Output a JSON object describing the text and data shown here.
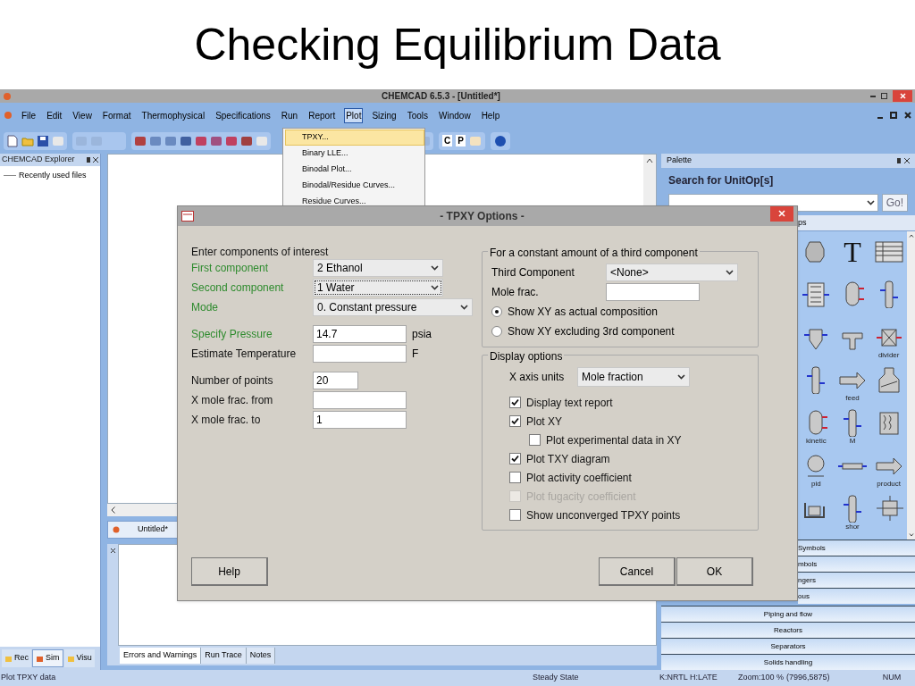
{
  "slide_title": "Checking Equilibrium Data",
  "window": {
    "title": "CHEMCAD 6.5.3 - [Untitled*]"
  },
  "menu": [
    {
      "label": "File",
      "selected": false
    },
    {
      "label": "Edit",
      "selected": false
    },
    {
      "label": "View",
      "selected": false
    },
    {
      "label": "Format",
      "selected": false
    },
    {
      "label": "Thermophysical",
      "selected": false
    },
    {
      "label": "Specifications",
      "selected": false
    },
    {
      "label": "Run",
      "selected": false
    },
    {
      "label": "Report",
      "selected": false
    },
    {
      "label": "Plot",
      "selected": true
    },
    {
      "label": "Sizing",
      "selected": false
    },
    {
      "label": "Tools",
      "selected": false
    },
    {
      "label": "Window",
      "selected": false
    },
    {
      "label": "Help",
      "selected": false
    }
  ],
  "plot_menu": [
    {
      "label": "TPXY...",
      "selected": true
    },
    {
      "label": "Binary LLE...",
      "selected": false
    },
    {
      "label": "Binodal Plot...",
      "selected": false
    },
    {
      "label": "Binodal/Residue Curves...",
      "selected": false
    },
    {
      "label": "Residue Curves...",
      "selected": false
    }
  ],
  "toolbar": {
    "letter_buttons": [
      "C",
      "P"
    ]
  },
  "explorer": {
    "title": "CHEMCAD Explorer",
    "items": [
      "Recently used files"
    ],
    "tabs": [
      {
        "label": "Rec",
        "selected": false
      },
      {
        "label": "Sim",
        "selected": true
      },
      {
        "label": "Visu",
        "selected": false
      }
    ]
  },
  "document_tab": "Untitled*",
  "message_tabs": [
    {
      "label": "Errors and Warnings",
      "selected": true
    },
    {
      "label": "Run Trace",
      "selected": false
    },
    {
      "label": "Notes",
      "selected": false
    }
  ],
  "palette": {
    "title": "Palette",
    "search_label": "Search for UnitOp[s]",
    "go_button": "Go!",
    "tab": "ps",
    "items": [
      {
        "kind": "icon"
      },
      {
        "kind": "glyph",
        "glyph": "T"
      },
      {
        "kind": "icon"
      },
      {
        "kind": "icon"
      },
      {
        "kind": "icon"
      },
      {
        "kind": "icon"
      },
      {
        "kind": "icon"
      },
      {
        "kind": "icon"
      },
      {
        "kind": "icon",
        "label": "divider"
      },
      {
        "kind": "icon"
      },
      {
        "kind": "icon",
        "label": "feed"
      },
      {
        "kind": "icon"
      },
      {
        "kind": "icon",
        "label": "kinetic"
      },
      {
        "kind": "icon",
        "label": "M"
      },
      {
        "kind": "icon"
      },
      {
        "kind": "icon",
        "label": "pid"
      },
      {
        "kind": "icon"
      },
      {
        "kind": "icon",
        "label": "product"
      },
      {
        "kind": "icon"
      },
      {
        "kind": "icon",
        "label": "shor"
      },
      {
        "kind": "icon"
      }
    ],
    "partial_categories": [
      "Symbols",
      "mbols",
      "ngers",
      "ous"
    ],
    "categories": [
      "Piping and flow",
      "Reactors",
      "Separators",
      "Solids handling"
    ]
  },
  "dialog": {
    "title": "- TPXY Options -",
    "section": "Enter components of interest",
    "field_groups": [
      [
        {
          "label": "First component",
          "required": true,
          "kind": "select",
          "value": "2 Ethanol",
          "focused": false
        },
        {
          "label": "Second component",
          "required": true,
          "kind": "select",
          "value": "1 Water",
          "focused": true
        },
        {
          "label": "Mode",
          "required": true,
          "kind": "wide_select",
          "value": "0. Constant pressure",
          "focused": false
        }
      ],
      [
        {
          "label": "Specify Pressure",
          "required": true,
          "kind": "input",
          "value": "14.7",
          "unit": "psia",
          "focused": false
        },
        {
          "label": "Estimate Temperature",
          "required": false,
          "kind": "input",
          "unit": "F",
          "focused": false
        }
      ],
      [
        {
          "label": "Number of points",
          "required": false,
          "kind": "short_input",
          "value": "20",
          "focused": false
        },
        {
          "label": "X mole frac. from",
          "required": false,
          "kind": "input",
          "focused": false
        },
        {
          "label": "X mole frac. to",
          "required": false,
          "kind": "input",
          "value": "1",
          "focused": false
        }
      ]
    ],
    "third_component": {
      "title": "For a constant amount of a third component",
      "component_label": "Third Component",
      "component_value": "<None>",
      "mole_frac_label": "Mole frac.",
      "options": [
        {
          "label": "Show XY as actual composition",
          "selected": true
        },
        {
          "label": "Show XY excluding 3rd component",
          "selected": false
        }
      ]
    },
    "display": {
      "title": "Display options",
      "x_axis_label": "X axis units",
      "x_axis_value": "Mole fraction",
      "checks": [
        {
          "label": "Display text report",
          "checked": true,
          "disabled": false
        },
        {
          "label": "Plot XY",
          "checked": true,
          "disabled": false,
          "children": [
            {
              "label": "Plot experimental data in XY",
              "checked": false,
              "disabled": false
            }
          ]
        },
        {
          "label": "Plot TXY diagram",
          "checked": true,
          "disabled": false
        },
        {
          "label": "Plot activity coefficient",
          "checked": false,
          "disabled": false
        },
        {
          "label": "Plot fugacity coefficient",
          "checked": false,
          "disabled": true
        },
        {
          "label": "Show unconverged TPXY points",
          "checked": false,
          "disabled": false
        }
      ]
    },
    "buttons": {
      "help": "Help",
      "cancel": "Cancel",
      "ok": "OK"
    }
  },
  "status_bar": [
    "Plot TPXY data",
    "Steady State",
    "K:NRTL H:LATE",
    "Zoom:100 %",
    "(7996,5875)",
    "NUM"
  ]
}
